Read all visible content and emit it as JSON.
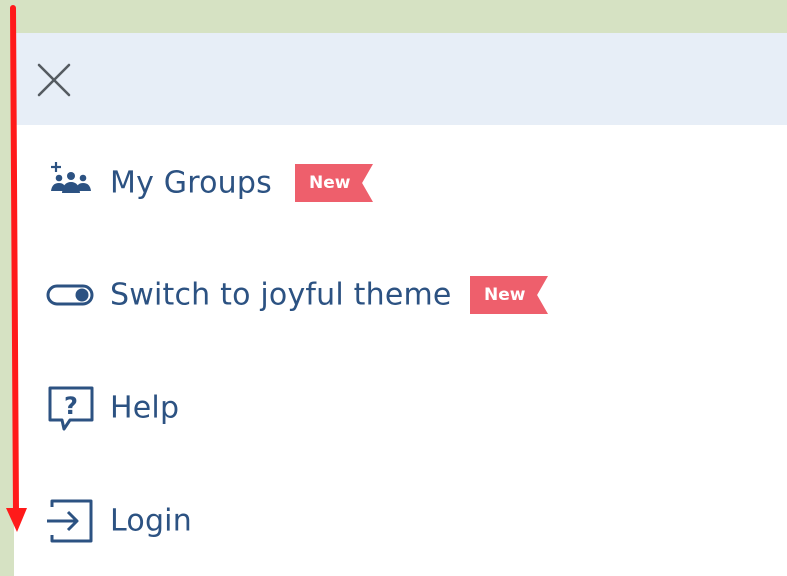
{
  "menu": {
    "items": [
      {
        "label": "My Groups",
        "badge": "New",
        "icon": "groups-icon"
      },
      {
        "label": "Switch to joyful theme",
        "badge": "New",
        "icon": "toggle-icon"
      },
      {
        "label": "Help",
        "icon": "help-icon"
      },
      {
        "label": "Login",
        "icon": "login-icon"
      }
    ]
  },
  "colors": {
    "background": "#d6e2c3",
    "header": "#e7eef7",
    "text": "#2c5282",
    "badge": "#ee5f6c",
    "arrow": "#ff1a1a"
  }
}
